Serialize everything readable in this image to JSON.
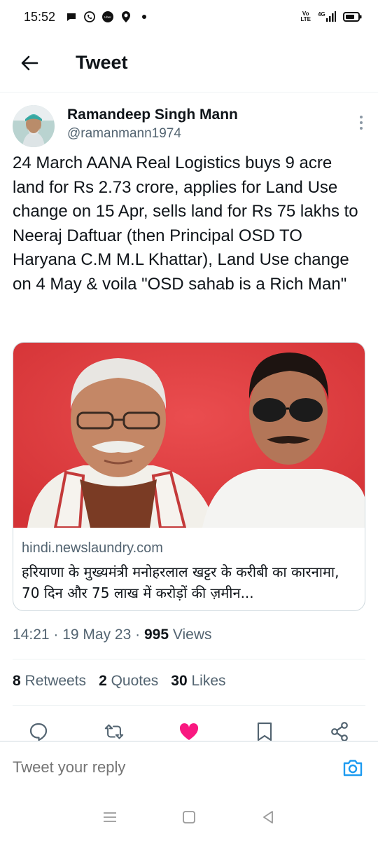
{
  "status_bar": {
    "time": "15:52",
    "left_icons": [
      "chat-bubble-icon",
      "whatsapp-icon",
      "uber-icon",
      "location-icon",
      "dot-icon"
    ],
    "right_icons": [
      "volte-icon",
      "signal-4g-icon",
      "battery-icon"
    ],
    "volte_top": "Vo",
    "volte_bottom": "LTE",
    "network": "4G",
    "uber_label": "Uber"
  },
  "header": {
    "title": "Tweet",
    "back_icon": "arrow-left-icon"
  },
  "author": {
    "name": "Ramandeep Singh Mann",
    "handle": "@ramanmann1974",
    "more_icon": "more-vertical-icon"
  },
  "tweet": {
    "text": "24 March AANA Real Logistics buys 9 acre land for Rs 2.73 crore, applies for Land Use change on 15 Apr, sells land for Rs 75 lakhs to Neeraj Daftuar (then Principal OSD TO Haryana C.M M.L Khattar), Land Use change on 4 May & voila \"OSD sahab is a Rich Man\""
  },
  "card": {
    "domain": "hindi.newslaundry.com",
    "title": "हरियाणा के मुख्यमंत्री मनोहरलाल खट्टर के करीबी का कारनामा, 70 दिन और 75 लाख में करोड़ों की ज़मीन..."
  },
  "meta": {
    "time": "14:21",
    "separator": " · ",
    "date": "19 May 23",
    "views_count": "995",
    "views_label": " Views"
  },
  "stats": {
    "retweets_count": "8",
    "retweets_label": " Retweets",
    "quotes_count": "2",
    "quotes_label": " Quotes",
    "likes_count": "30",
    "likes_label": " Likes"
  },
  "actions": {
    "icons": [
      "reply-icon",
      "retweet-icon",
      "like-icon",
      "bookmark-icon",
      "share-icon"
    ],
    "like_color": "#f91880"
  },
  "reply": {
    "placeholder": "Tweet your reply",
    "camera_icon": "camera-icon",
    "accent": "#1d9bf0"
  },
  "nav": {
    "icons": [
      "menu-icon",
      "home-icon",
      "back-icon"
    ]
  }
}
